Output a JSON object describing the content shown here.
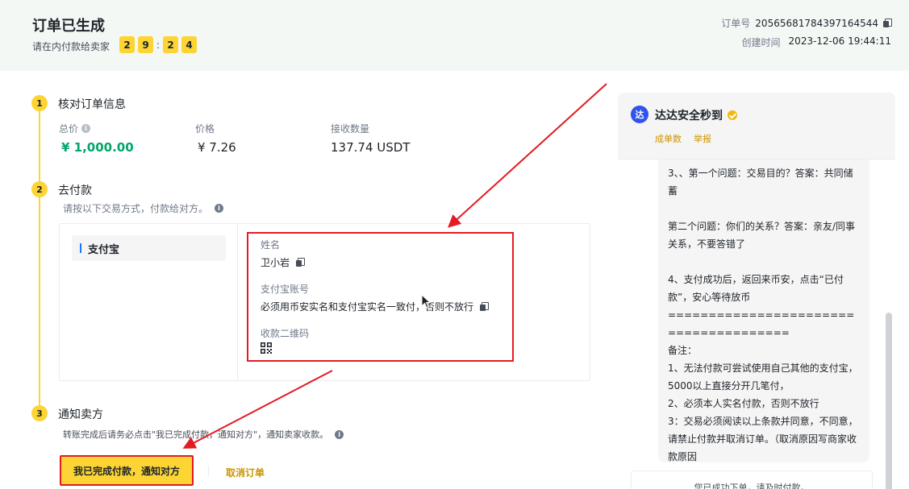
{
  "header": {
    "title": "订单已生成",
    "subtitle": "请在内付款给卖家",
    "timer": [
      "2",
      "9",
      "2",
      "4"
    ],
    "order_no_label": "订单号",
    "order_no": "20565681784397164544",
    "created_label": "创建时间",
    "created": "2023-12-06 19:44:11"
  },
  "steps": [
    {
      "num": "1",
      "title": "核对订单信息"
    },
    {
      "num": "2",
      "title": "去付款"
    },
    {
      "num": "3",
      "title": "通知卖方"
    }
  ],
  "order_info": {
    "total_label": "总价",
    "total": "¥ 1,000.00",
    "price_label": "价格",
    "price": "¥ 7.26",
    "qty_label": "接收数量",
    "qty": "137.74 USDT"
  },
  "payment": {
    "hint": "请按以下交易方式，付款给对方。",
    "method": "支付宝",
    "name_label": "姓名",
    "name": "卫小岩",
    "account_label": "支付宝账号",
    "account": "必须用币安实名和支付宝实名一致付，否则不放行",
    "qr_label": "收款二维码"
  },
  "notify": {
    "hint": "转账完成后请务必点击\"我已完成付款，通知对方\"，通知卖家收款。",
    "done_button": "我已完成付款，通知对方",
    "cancel_button": "取消订单"
  },
  "chat": {
    "avatar": "达",
    "name": "达达安全秒到",
    "stat_orders": "成单数",
    "stat_report": "举报",
    "message": "3、、第一个问题：交易目的？答案：共同储蓄\n\n第二个问题：你们的关系？答案：亲友/同事关系，不要答错了\n\n4、支付成功后，返回来币安，点击“已付款”，安心等待放币\n======================================\n备注：\n1、无法付款可尝试使用自己其他的支付宝，5000以上直接分开几笔付，\n2、必须本人实名付款，否则不放行\n3：交易必须阅读以上条款并同意，不同意，请禁止付款并取消订单。（取消原因写商家收款原因",
    "toast": "您已成功下单，请及时付款。"
  },
  "colors": {
    "accent": "#fcd535",
    "annotation_red": "#e31b23",
    "price_green": "#02a66a",
    "link_gold": "#c99400"
  }
}
